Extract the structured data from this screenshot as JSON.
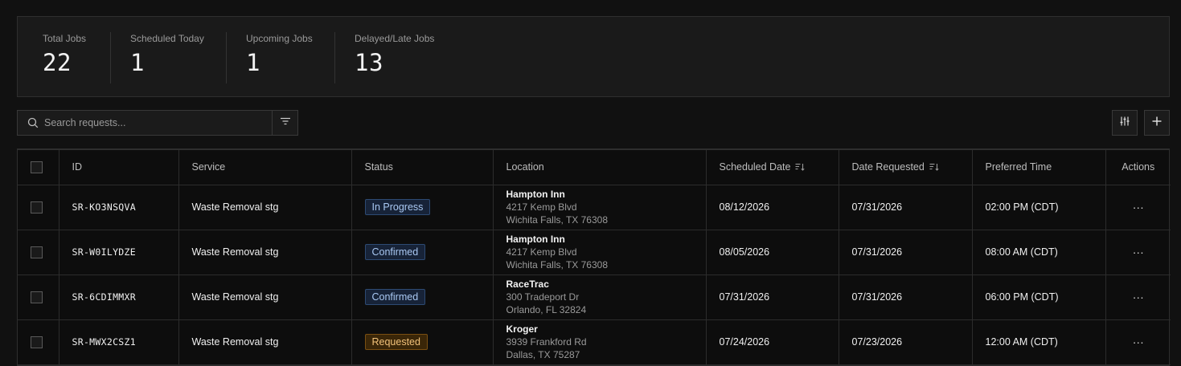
{
  "stats": [
    {
      "label": "Total Jobs",
      "value": "22"
    },
    {
      "label": "Scheduled Today",
      "value": "1"
    },
    {
      "label": "Upcoming Jobs",
      "value": "1"
    },
    {
      "label": "Delayed/Late Jobs",
      "value": "13"
    }
  ],
  "search": {
    "placeholder": "Search requests..."
  },
  "icons": {
    "search": "search-icon",
    "filter": "filter-icon",
    "columns": "sliders-icon",
    "add": "plus-icon",
    "sort": "sort-icon",
    "more": "more-horizontal-icon"
  },
  "table": {
    "headers": {
      "id": "ID",
      "service": "Service",
      "status": "Status",
      "location": "Location",
      "scheduled_date": "Scheduled Date",
      "date_requested": "Date Requested",
      "preferred_time": "Preferred Time",
      "actions": "Actions"
    },
    "rows": [
      {
        "id": "SR-KO3NSQVA",
        "service": "Waste Removal stg",
        "status": "In Progress",
        "location_name": "Hampton Inn",
        "address1": "4217 Kemp Blvd",
        "address2": "Wichita Falls, TX 76308",
        "scheduled_date": "08/12/2026",
        "date_requested": "07/31/2026",
        "preferred_time": "02:00 PM (CDT)",
        "actions": "···"
      },
      {
        "id": "SR-W0ILYDZE",
        "service": "Waste Removal stg",
        "status": "Confirmed",
        "location_name": "Hampton Inn",
        "address1": "4217 Kemp Blvd",
        "address2": "Wichita Falls, TX 76308",
        "scheduled_date": "08/05/2026",
        "date_requested": "07/31/2026",
        "preferred_time": "08:00 AM (CDT)",
        "actions": "···"
      },
      {
        "id": "SR-6CDIMMXR",
        "service": "Waste Removal stg",
        "status": "Confirmed",
        "location_name": "RaceTrac",
        "address1": "300 Tradeport Dr",
        "address2": "Orlando, FL 32824",
        "scheduled_date": "07/31/2026",
        "date_requested": "07/31/2026",
        "preferred_time": "06:00 PM (CDT)",
        "actions": "···"
      },
      {
        "id": "SR-MWX2CSZ1",
        "service": "Waste Removal stg",
        "status": "Requested",
        "location_name": "Kroger",
        "address1": "3939 Frankford Rd",
        "address2": "Dallas, TX 75287",
        "scheduled_date": "07/24/2026",
        "date_requested": "07/23/2026",
        "preferred_time": "12:00 AM (CDT)",
        "actions": "···"
      }
    ]
  },
  "colors": {
    "background": "#111111",
    "status_in_progress": "#a9c8f2",
    "status_confirmed": "#a9c8f2",
    "status_requested": "#f2c27a"
  }
}
